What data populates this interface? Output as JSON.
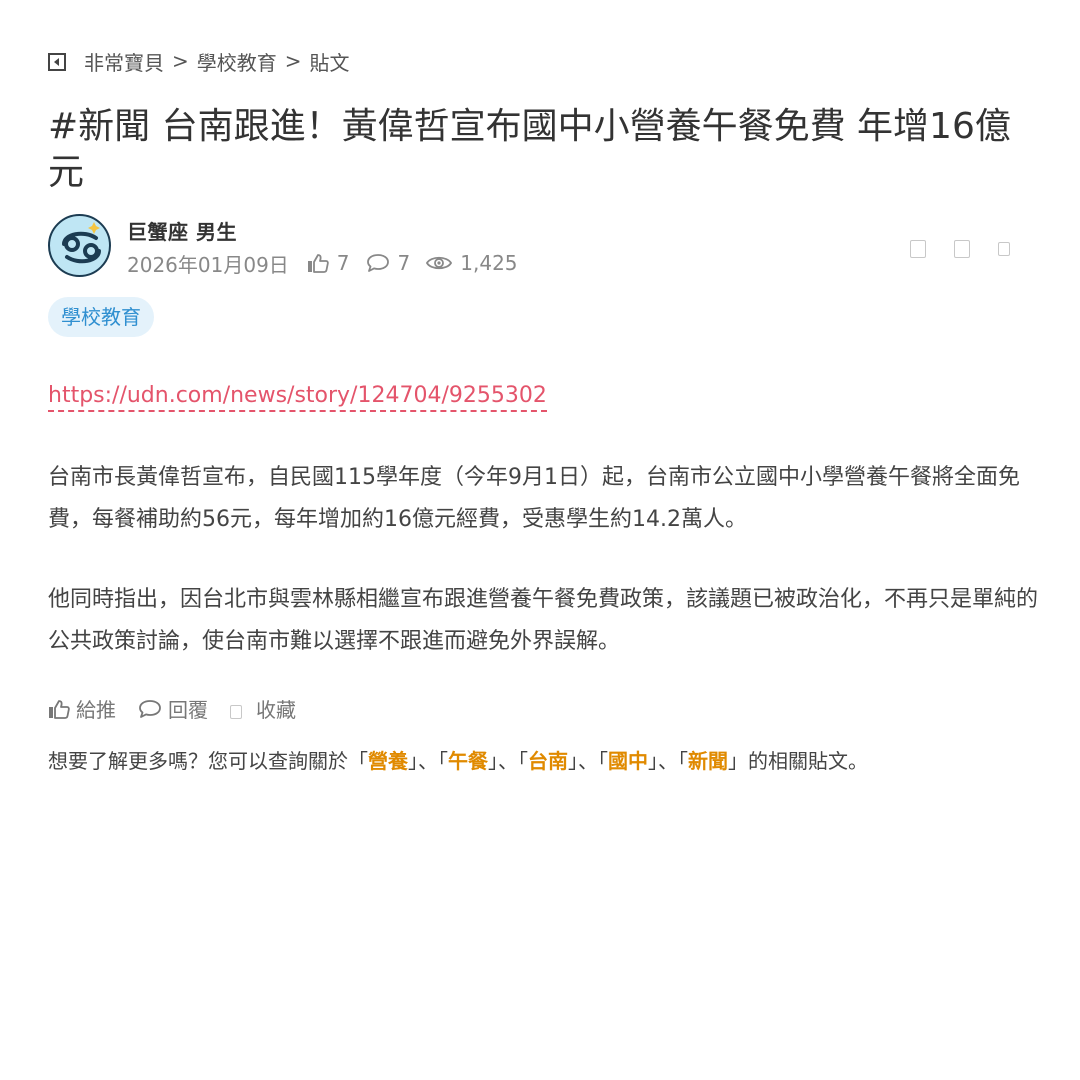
{
  "breadcrumb": {
    "items": [
      "非常寶貝",
      "學校教育",
      "貼文"
    ],
    "separator": ">"
  },
  "post": {
    "title": "#新聞 台南跟進！黃偉哲宣布國中小營養午餐免費 年增16億元",
    "author": "巨蟹座 男生",
    "date": "2026年01月09日",
    "likes": "7",
    "comments": "7",
    "views": "1,425",
    "tag": "學校教育",
    "link": "https://udn.com/news/story/124704/9255302",
    "paragraphs": [
      "台南市長黃偉哲宣布，自民國115學年度（今年9月1日）起，台南市公立國中小學營養午餐將全面免費，每餐補助約56元，每年增加約16億元經費，受惠學生約14.2萬人。",
      "他同時指出，因台北市與雲林縣相繼宣布跟進營養午餐免費政策，該議題已被政治化，不再只是單純的公共政策討論，使台南市難以選擇不跟進而避免外界誤解。"
    ]
  },
  "actions": {
    "like": "給推",
    "reply": "回覆",
    "save": "收藏"
  },
  "related": {
    "prefix": "想要了解更多嗎？您可以查詢關於「",
    "keywords": [
      "營養",
      "午餐",
      "台南",
      "國中",
      "新聞"
    ],
    "sep": "」、「",
    "suffix": "」的相關貼文。"
  },
  "colors": {
    "link": "#e4546b",
    "tag_bg": "#e4f2fb",
    "tag_text": "#2f8fd0",
    "keyword": "#e08a00"
  },
  "icons": {
    "back": "back-square-icon",
    "like": "thumbs-up-icon",
    "comment": "speech-bubble-icon",
    "views": "eye-icon",
    "avatar": "cancer-zodiac-icon"
  }
}
